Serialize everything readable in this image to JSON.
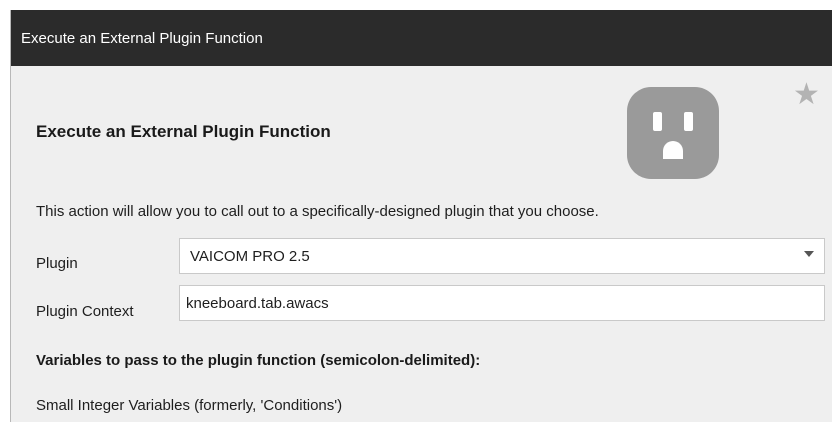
{
  "window": {
    "title": "Execute an External Plugin Function"
  },
  "header": {
    "heading": "Execute an External Plugin Function",
    "icon": "power-outlet-icon",
    "favorite_icon": "star-icon"
  },
  "description": "This action will allow you to call out to a specifically-designed plugin that you choose.",
  "plugin": {
    "label": "Plugin",
    "selected": "VAICOM PRO 2.5"
  },
  "plugin_context": {
    "label": "Plugin Context",
    "value": "kneeboard.tab.awacs"
  },
  "variables": {
    "heading": "Variables to pass to the plugin function (semicolon-delimited):",
    "small_integer_label": "Small Integer Variables (formerly, 'Conditions')"
  },
  "colors": {
    "titlebar": "#2b2b2b",
    "background": "#efefef",
    "icon_gray": "#9a9a9a",
    "star_gray": "#b3b3b3"
  }
}
